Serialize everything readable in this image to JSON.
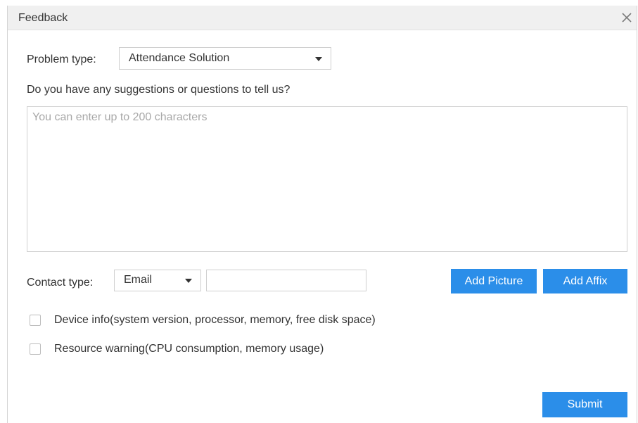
{
  "dialog": {
    "title": "Feedback"
  },
  "problem": {
    "label": "Problem type:",
    "selected": "Attendance Solution"
  },
  "question": {
    "label": "Do you have any suggestions or questions to tell us?",
    "placeholder": "You can enter up to 200 characters",
    "value": ""
  },
  "contact": {
    "label": "Contact type:",
    "selected": "Email",
    "value": ""
  },
  "buttons": {
    "add_picture": "Add Picture",
    "add_affix": "Add Affix",
    "submit": "Submit"
  },
  "options": [
    {
      "label": "Device info(system version, processor, memory, free disk space)",
      "checked": false
    },
    {
      "label": "Resource warning(CPU consumption, memory usage)",
      "checked": false
    }
  ],
  "icons": {
    "close": "close-icon",
    "dropdown": "caret-down-icon"
  },
  "colors": {
    "accent": "#2b8ee9",
    "titlebar": "#f0f0f0"
  }
}
